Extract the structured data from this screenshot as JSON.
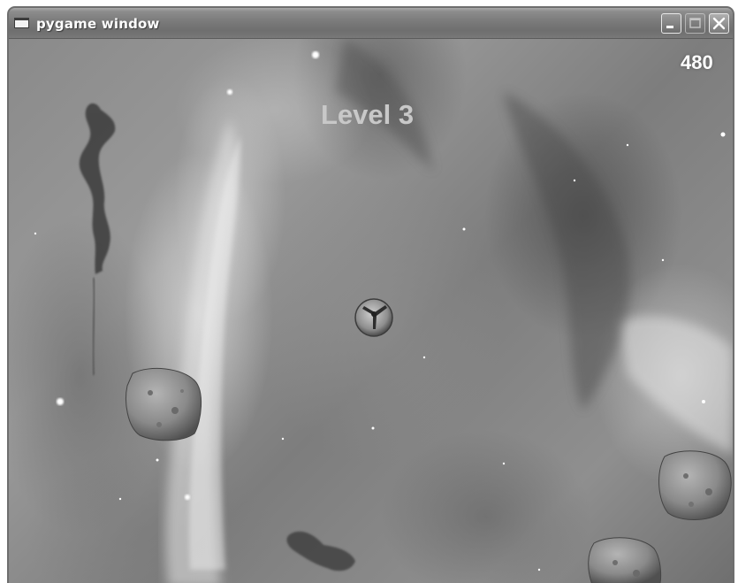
{
  "window": {
    "title": "pygame window",
    "icons": {
      "app": "window-app-icon",
      "minimize": "minimize-icon",
      "maximize": "maximize-icon",
      "close": "close-icon"
    }
  },
  "hud": {
    "score": "480",
    "level_label": "Level 3"
  },
  "sprites": {
    "ship": "spaceship",
    "asteroids": [
      "asteroid",
      "asteroid",
      "asteroid"
    ]
  },
  "colors": {
    "title_text": "#ffffff",
    "score_text": "#ffffff",
    "level_text": "#c8c8c8"
  }
}
